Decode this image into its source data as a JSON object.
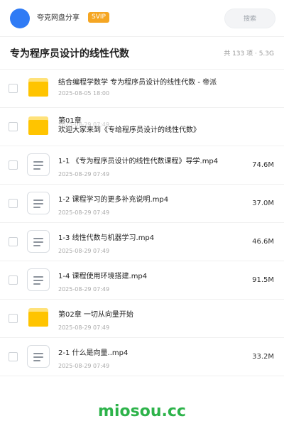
{
  "header": {
    "brand": "夸克网盘分享",
    "badge": "SVIP",
    "search_label": "搜索"
  },
  "title_bar": {
    "title": "专为程序员设计的线性代数",
    "summary": "共 133 项 · 5.3G"
  },
  "files": [
    {
      "type": "folder",
      "name": "结合编程学数学 专为程序员设计的线性代数 - 帝派",
      "meta": "2025-08-05 18:00",
      "size": ""
    },
    {
      "type": "folder",
      "name": "第01章\n欢迎大家来到《专给程序员设计的线性代数》",
      "meta": "2025-08-29 07:49",
      "size": ""
    },
    {
      "type": "file",
      "name": "1-1 《专为程序员设计的线性代数课程》导学.mp4",
      "meta": "2025-08-29 07:49",
      "size": "74.6M"
    },
    {
      "type": "file",
      "name": "1-2 课程学习的更多补充说明.mp4",
      "meta": "2025-08-29 07:49",
      "size": "37.0M"
    },
    {
      "type": "file",
      "name": "1-3 线性代数与机器学习.mp4",
      "meta": "2025-08-29 07:49",
      "size": "46.6M"
    },
    {
      "type": "file",
      "name": "1-4 课程使用环境搭建.mp4",
      "meta": "2025-08-29 07:49",
      "size": "91.5M"
    },
    {
      "type": "folder",
      "name": "第02章 一切从向量开始",
      "meta": "2025-08-29 07:49",
      "size": ""
    },
    {
      "type": "file",
      "name": "2-1 什么是向量..mp4",
      "meta": "2025-08-29 07:49",
      "size": "33.2M"
    }
  ],
  "footer": {
    "watermark": "miosou.cc"
  },
  "colors": {
    "avatar": "#2f7bf5",
    "svip": "#f5a623",
    "folder": "#ffc400",
    "watermark": "#2db34a"
  }
}
